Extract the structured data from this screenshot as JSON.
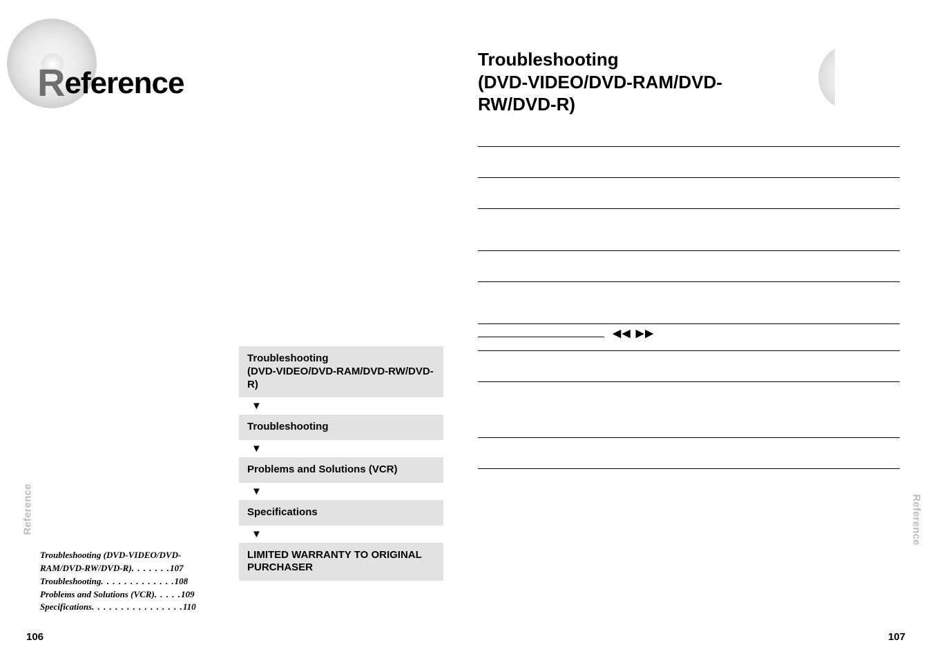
{
  "left": {
    "sidebar_label": "Reference",
    "sidebar_accent_char": "R",
    "hero_title_rest": "eference",
    "toc": [
      {
        "label_a": "Troubleshooting (DVD-VIDEO/DVD-",
        "label_b": "RAM/DVD-RW/DVD-R)",
        "leader": "  . . . . . . . ",
        "page": "107"
      },
      {
        "label_a": "Troubleshooting",
        "leader": "   . . . . . . . . . . . . . ",
        "page": "108"
      },
      {
        "label_a": "Problems and Solutions (VCR)",
        "leader": "  . . . . . ",
        "page": "109"
      },
      {
        "label_a": "Specifications",
        "leader": "   . . . . . . . . . . . . . . . . ",
        "page": "110"
      }
    ],
    "flow": [
      "Troubleshooting\n(DVD-VIDEO/DVD-RAM/DVD-RW/DVD-R)",
      "Troubleshooting",
      "Problems and Solutions (VCR)",
      "Specifications",
      "LIMITED WARRANTY TO ORIGINAL PURCHASER"
    ],
    "flow_arrow_glyph": "▼",
    "page_number": "106"
  },
  "right": {
    "title_line1": "Troubleshooting",
    "title_line2": "(DVD-VIDEO/DVD-RAM/DVD-RW/DVD-R)",
    "transport_glyphs": "◀◀      ▶▶",
    "sidebar_label": "Reference",
    "page_number": "107"
  }
}
